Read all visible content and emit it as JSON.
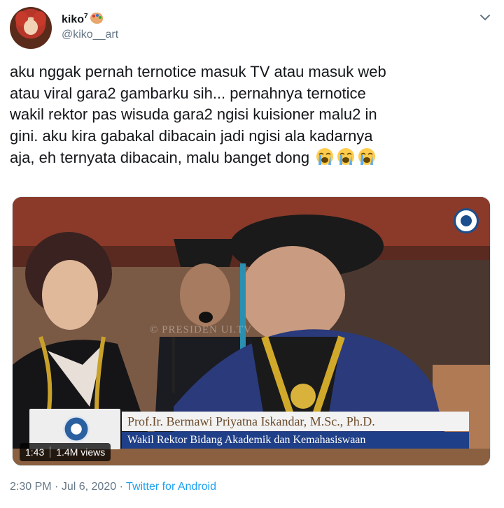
{
  "author": {
    "display_name": "kiko",
    "superscript": "7",
    "handle": "@kiko__art",
    "avatar_icon": "profile-avatar",
    "badge_icon": "artist-palette-icon"
  },
  "menu": {
    "icon": "chevron-down-icon"
  },
  "tweet": {
    "lines": [
      "aku nggak pernah ternotice masuk TV atau masuk web",
      "atau viral gara2 gambarku sih... pernahnya ternotice",
      "wakil rektor pas wisuda gara2 ngisi kuisioner malu2 in",
      "gini. aku kira gabakal dibacain jadi ngisi ala kadarnya",
      "aja, eh ternyata dibacain, malu banget dong"
    ],
    "emoji": [
      "loudly-crying-face-icon",
      "loudly-crying-face-icon",
      "loudly-crying-face-icon"
    ]
  },
  "video": {
    "watermark": "© PRESIDEN UI.TV",
    "lower_third_name": "Prof.Ir. Bermawi Priyatna Iskandar, M.Sc., Ph.D.",
    "lower_third_title": "Wakil Rektor Bidang Akademik dan Kemahasiswaan",
    "duration": "1:43",
    "views": "1.4M views"
  },
  "footer": {
    "time": "2:30 PM",
    "separator": "·",
    "date": "Jul 6, 2020",
    "source": "Twitter for Android"
  },
  "colors": {
    "text": "#14171a",
    "secondary": "#657786",
    "link": "#1da1f2",
    "lower_third_blue": "#1f3f88"
  }
}
